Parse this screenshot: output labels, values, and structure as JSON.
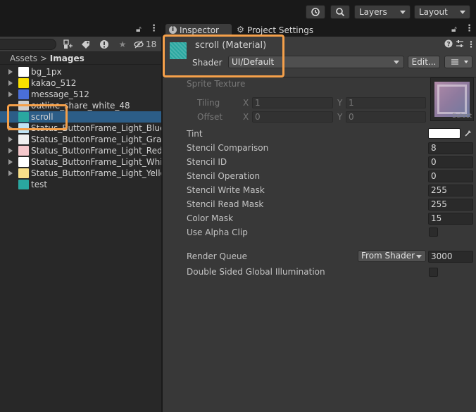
{
  "toolbar": {
    "layers_label": "Layers",
    "layout_label": "Layout"
  },
  "project": {
    "visibility_count": "18",
    "breadcrumb_root": "Assets",
    "breadcrumb_sep": ">",
    "breadcrumb_current": "Images",
    "files": [
      {
        "name": "bg_1px",
        "icon_color": "#ffffff",
        "foldable": true
      },
      {
        "name": "kakao_512",
        "icon_color": "#f9e000",
        "foldable": true
      },
      {
        "name": "message_512",
        "icon_color": "#4a6fd8",
        "foldable": true
      },
      {
        "name": "outline_share_white_48",
        "icon_color": "#cfcfcf",
        "foldable": false
      },
      {
        "name": "scroll",
        "icon_color": "#2aa7a0",
        "foldable": false,
        "selected": true
      },
      {
        "name": "Status_ButtonFrame_Light_Blue",
        "icon_color": "#bfe3f5",
        "foldable": true
      },
      {
        "name": "Status_ButtonFrame_Light_Gray",
        "icon_color": "#f0f0f0",
        "foldable": true
      },
      {
        "name": "Status_ButtonFrame_Light_Red",
        "icon_color": "#f5c8cc",
        "foldable": true
      },
      {
        "name": "Status_ButtonFrame_Light_White",
        "icon_color": "#ffffff",
        "foldable": true
      },
      {
        "name": "Status_ButtonFrame_Light_Yellow",
        "icon_color": "#f8e08a",
        "foldable": true
      },
      {
        "name": "test",
        "icon_color": "#2aa7a0",
        "foldable": false
      }
    ]
  },
  "inspector": {
    "tab_inspector": "Inspector",
    "tab_project_settings": "Project Settings",
    "material_title": "scroll (Material)",
    "shader_label": "Shader",
    "shader_value": "UI/Default",
    "edit_label": "Edit...",
    "sprite_texture_label": "Sprite Texture",
    "texture_select": "Select",
    "tiling_label": "Tiling",
    "offset_label": "Offset",
    "x_label": "X",
    "y_label": "Y",
    "tiling_x": "1",
    "tiling_y": "1",
    "offset_x": "0",
    "offset_y": "0",
    "tint_label": "Tint",
    "tint_color": "#ffffff",
    "stencil_comparison_label": "Stencil Comparison",
    "stencil_comparison": "8",
    "stencil_id_label": "Stencil ID",
    "stencil_id": "0",
    "stencil_operation_label": "Stencil Operation",
    "stencil_operation": "0",
    "stencil_write_mask_label": "Stencil Write Mask",
    "stencil_write_mask": "255",
    "stencil_read_mask_label": "Stencil Read Mask",
    "stencil_read_mask": "255",
    "color_mask_label": "Color Mask",
    "color_mask": "15",
    "use_alpha_clip_label": "Use Alpha Clip",
    "render_queue_label": "Render Queue",
    "render_queue_mode": "From Shader",
    "render_queue_value": "3000",
    "double_sided_gi_label": "Double Sided Global Illumination"
  },
  "colors": {
    "highlight": "#f5a04a",
    "selection": "#2c5d87"
  }
}
